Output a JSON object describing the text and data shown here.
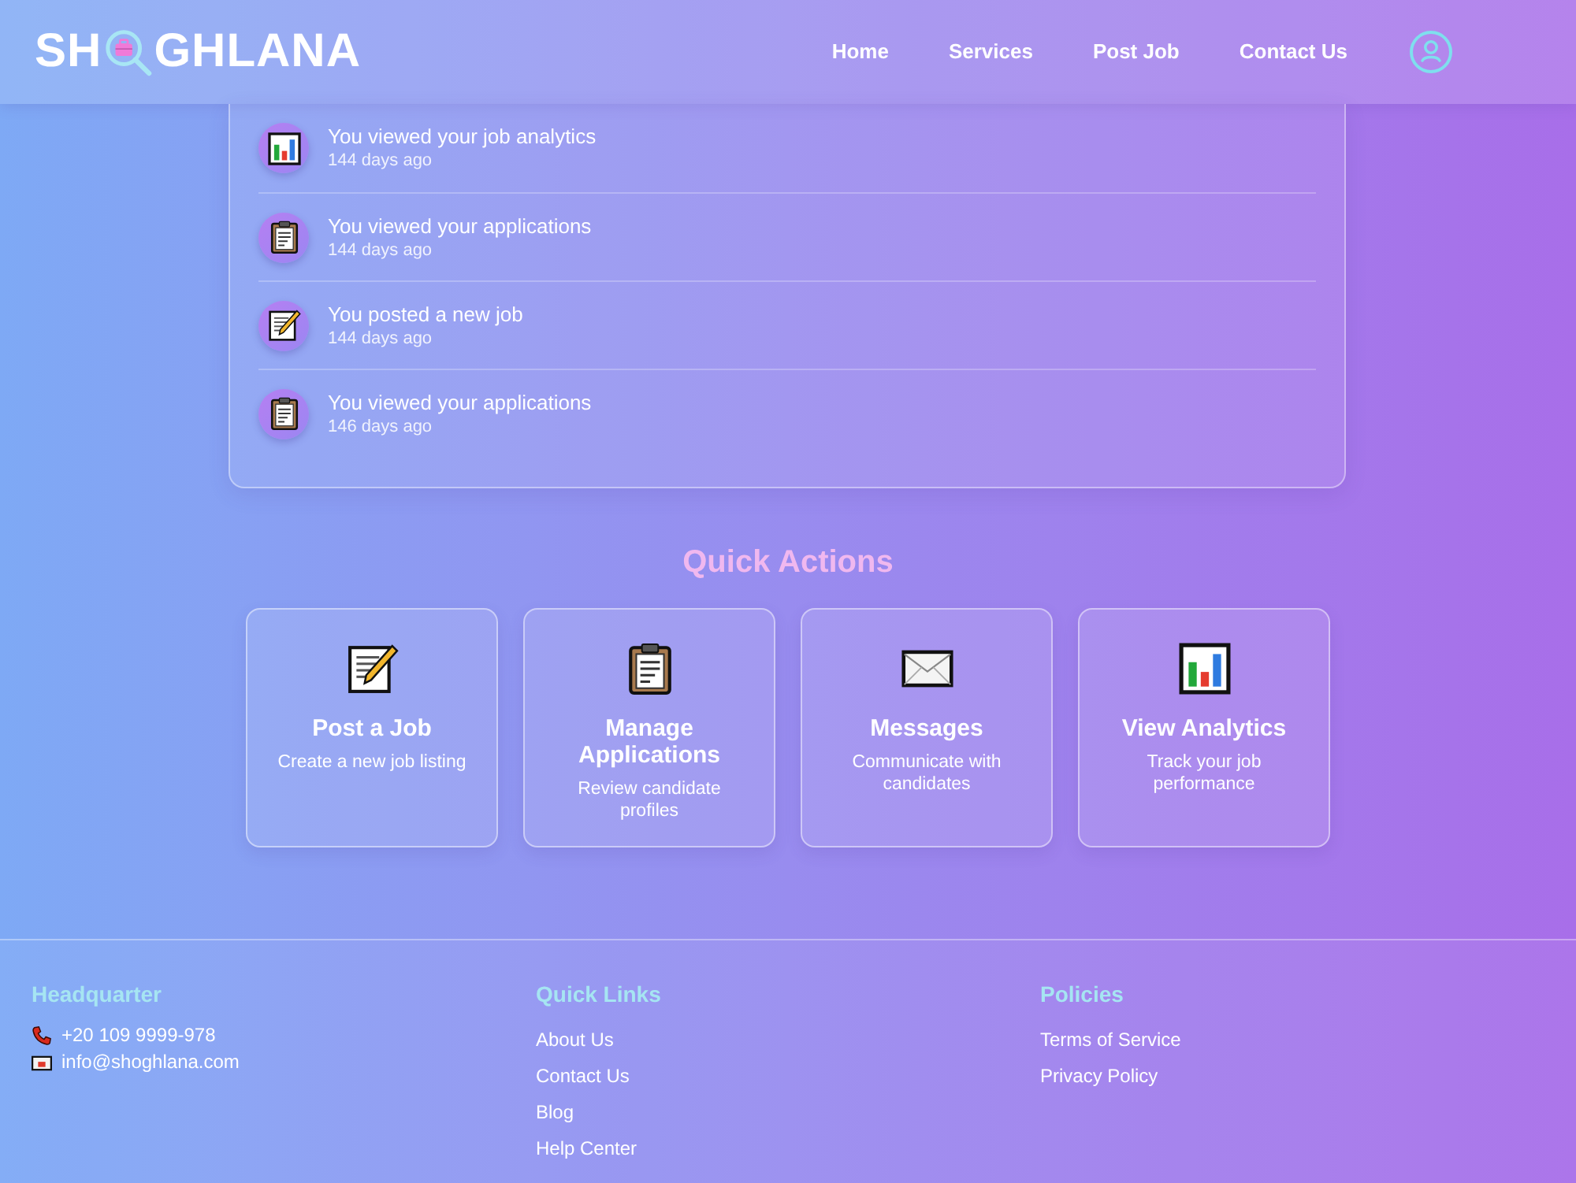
{
  "header": {
    "logo": [
      "SH",
      "GHLANA"
    ],
    "nav": [
      "Home",
      "Services",
      "Post Job",
      "Contact Us"
    ]
  },
  "activity": [
    {
      "kind": "chart",
      "title": "You viewed your job analytics",
      "time": "144 days ago"
    },
    {
      "kind": "clipboard",
      "title": "You viewed your applications",
      "time": "144 days ago"
    },
    {
      "kind": "memo",
      "title": "You posted a new job",
      "time": "144 days ago"
    },
    {
      "kind": "clipboard",
      "title": "You viewed your applications",
      "time": "146 days ago"
    }
  ],
  "quick_actions": {
    "title": "Quick Actions",
    "cards": [
      {
        "kind": "memo",
        "title": "Post a Job",
        "description": "Create a new job listing"
      },
      {
        "kind": "clipboard",
        "title": "Manage Applications",
        "description": "Review candidate profiles"
      },
      {
        "kind": "envelope",
        "title": "Messages",
        "description": "Communicate with candidates"
      },
      {
        "kind": "chart",
        "title": "View Analytics",
        "description": "Track your job performance"
      }
    ]
  },
  "footer": {
    "columns": [
      {
        "heading": "Headquarter",
        "items": [
          {
            "kind": "phone",
            "text": "+20 109 9999-978"
          },
          {
            "kind": "email",
            "text": "info@shoghlana.com"
          }
        ]
      },
      {
        "heading": "Quick Links",
        "items": [
          {
            "kind": "link",
            "text": "About Us"
          },
          {
            "kind": "link",
            "text": "Contact Us"
          },
          {
            "kind": "link",
            "text": "Blog"
          },
          {
            "kind": "link",
            "text": "Help Center"
          }
        ]
      },
      {
        "heading": "Policies",
        "items": [
          {
            "kind": "link",
            "text": "Terms of Service"
          },
          {
            "kind": "link",
            "text": "Privacy Policy"
          }
        ]
      }
    ]
  }
}
